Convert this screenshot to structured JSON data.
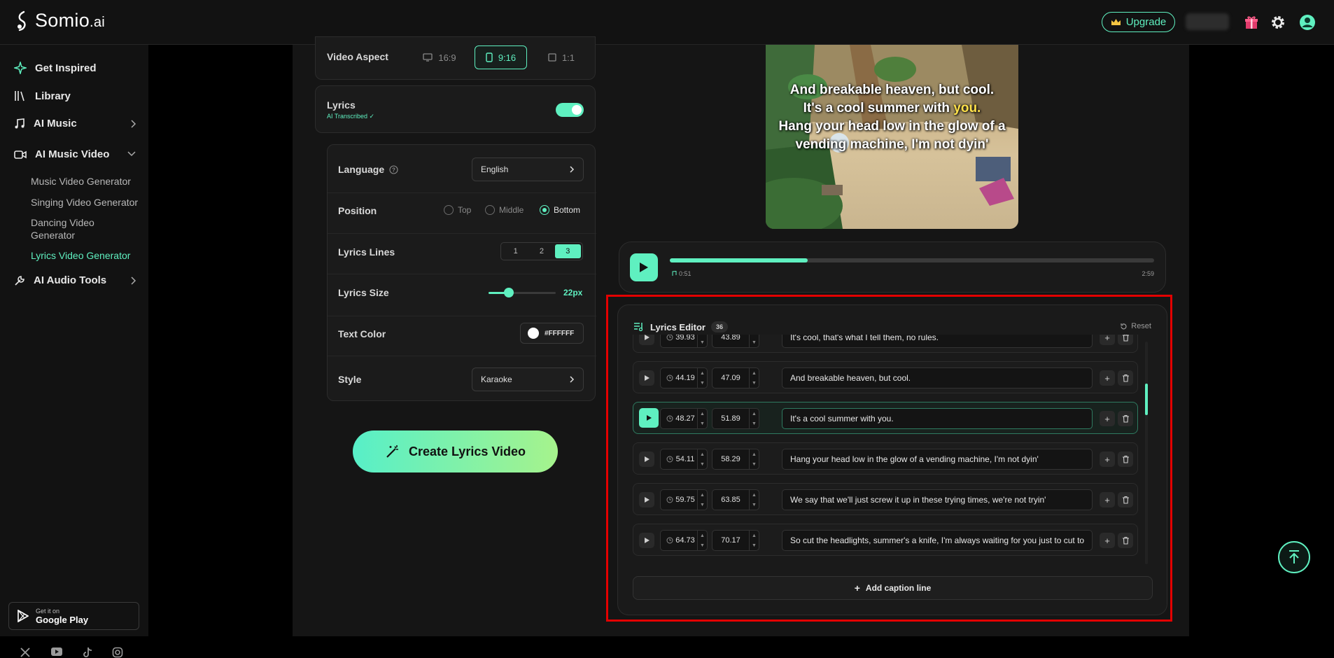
{
  "app": {
    "logo_text": "Somio",
    "logo_suffix": ".ai"
  },
  "header": {
    "upgrade_label": "Upgrade"
  },
  "sidebar": {
    "items": [
      {
        "label": "Get Inspired"
      },
      {
        "label": "Library"
      },
      {
        "label": "AI Music"
      },
      {
        "label": "AI Music Video"
      },
      {
        "label": "AI Audio Tools"
      }
    ],
    "sub_items": [
      {
        "label": "Music Video Generator"
      },
      {
        "label": "Singing Video Generator"
      },
      {
        "label": "Dancing Video Generator"
      },
      {
        "label": "Lyrics Video Generator"
      }
    ],
    "google_play": {
      "small": "Get it on",
      "big": "Google Play"
    }
  },
  "settings": {
    "video_aspect": {
      "label": "Video Aspect",
      "options": [
        "16:9",
        "9:16",
        "1:1"
      ],
      "selected": "9:16"
    },
    "lyrics": {
      "label": "Lyrics",
      "sub": "AI Transcribed ✓",
      "enabled": true
    },
    "language": {
      "label": "Language",
      "value": "English"
    },
    "position": {
      "label": "Position",
      "options": [
        "Top",
        "Middle",
        "Bottom"
      ],
      "selected": "Bottom"
    },
    "lyrics_lines": {
      "label": "Lyrics Lines",
      "options": [
        "1",
        "2",
        "3"
      ],
      "selected": "3"
    },
    "lyrics_size": {
      "label": "Lyrics Size",
      "value": "22px",
      "level": 0.3
    },
    "text_color": {
      "label": "Text Color",
      "value": "#FFFFFF"
    },
    "style": {
      "label": "Style",
      "value": "Karaoke"
    },
    "create_label": "Create Lyrics Video"
  },
  "preview": {
    "lines": [
      {
        "text": "And breakable heaven, but cool."
      },
      {
        "before": "It's a cool summer with ",
        "highlight": "you."
      },
      {
        "text": "Hang your head low in the glow of a vending machine, I'm not dyin'"
      }
    ]
  },
  "player": {
    "current": "0:51",
    "total": "2:59",
    "progress": 0.285
  },
  "editor": {
    "title": "Lyrics Editor",
    "count": "36",
    "reset_label": "Reset",
    "add_label": "Add caption line",
    "rows": [
      {
        "start": "39.93",
        "end": "43.89",
        "text": "It's cool, that's what I tell them, no rules."
      },
      {
        "start": "44.19",
        "end": "47.09",
        "text": "And breakable heaven, but cool."
      },
      {
        "start": "48.27",
        "end": "51.89",
        "text": "It's a cool summer with you.",
        "active": true
      },
      {
        "start": "54.11",
        "end": "58.29",
        "text": "Hang your head low in the glow of a vending machine, I'm not dyin'"
      },
      {
        "start": "59.75",
        "end": "63.85",
        "text": "We say that we'll just screw it up in these trying times, we're not tryin'"
      },
      {
        "start": "64.73",
        "end": "70.17",
        "text": "So cut the headlights, summer's a knife, I'm always waiting for you just to cut to"
      }
    ]
  },
  "colors": {
    "accent": "#5ff0c0",
    "highlight_box": "#e30000",
    "karaoke": "#ffe14a"
  }
}
